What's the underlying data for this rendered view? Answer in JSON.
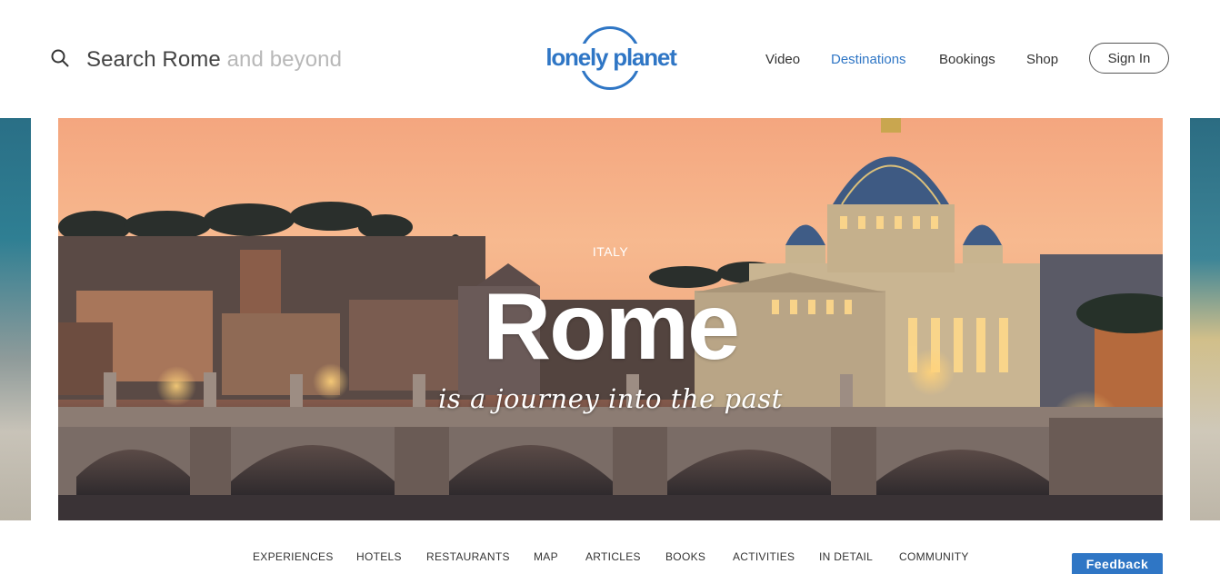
{
  "header": {
    "search": {
      "prefix": "Search Rome",
      "suffix": " and beyond"
    },
    "logo_text": "lonely planet",
    "nav": [
      {
        "label": "Video"
      },
      {
        "label": "Destinations"
      },
      {
        "label": "Bookings"
      },
      {
        "label": "Shop"
      }
    ],
    "sign_in": "Sign In"
  },
  "hero": {
    "country": "ITALY",
    "title": "Rome",
    "subtitle": "is a journey into the past"
  },
  "subnav": [
    {
      "label": "EXPERIENCES"
    },
    {
      "label": "HOTELS"
    },
    {
      "label": "RESTAURANTS"
    },
    {
      "label": "MAP"
    },
    {
      "label": "ARTICLES"
    },
    {
      "label": "BOOKS"
    },
    {
      "label": "ACTIVITIES"
    },
    {
      "label": "IN DETAIL"
    },
    {
      "label": "COMMUNITY"
    }
  ],
  "feedback": "Feedback",
  "colors": {
    "brand": "#2f76c5",
    "active_nav": "#2f76c5"
  }
}
